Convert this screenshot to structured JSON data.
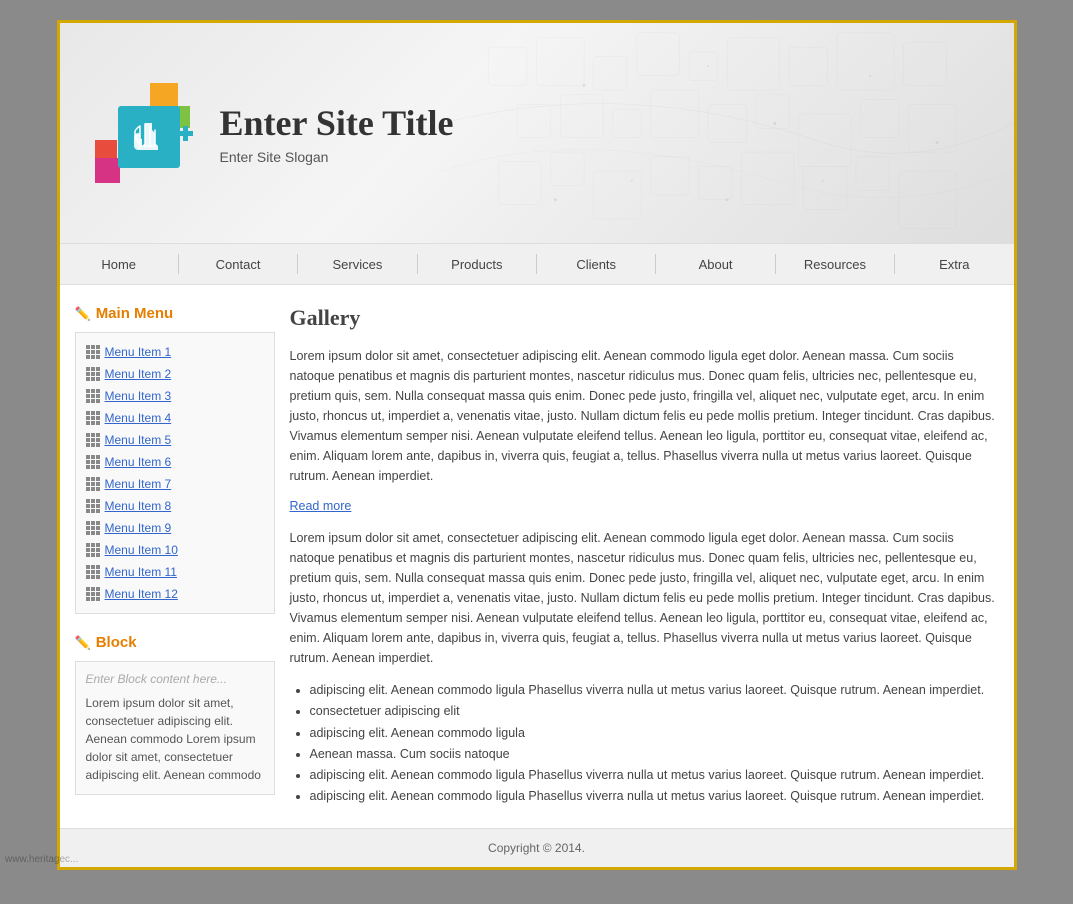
{
  "header": {
    "site_title": "Enter Site Title",
    "site_slogan": "Enter Site Slogan"
  },
  "nav": {
    "items": [
      {
        "label": "Home"
      },
      {
        "label": "Contact"
      },
      {
        "label": "Services"
      },
      {
        "label": "Products"
      },
      {
        "label": "Clients"
      },
      {
        "label": "About"
      },
      {
        "label": "Resources"
      },
      {
        "label": "Extra"
      }
    ]
  },
  "sidebar": {
    "main_menu_title": "Main Menu",
    "menu_items": [
      {
        "label": "Menu Item 1"
      },
      {
        "label": "Menu Item 2"
      },
      {
        "label": "Menu Item 3"
      },
      {
        "label": "Menu Item 4"
      },
      {
        "label": "Menu Item 5"
      },
      {
        "label": "Menu Item 6"
      },
      {
        "label": "Menu Item 7"
      },
      {
        "label": "Menu Item 8"
      },
      {
        "label": "Menu Item 9"
      },
      {
        "label": "Menu Item 10"
      },
      {
        "label": "Menu Item 11"
      },
      {
        "label": "Menu Item 12"
      }
    ],
    "block_title": "Block",
    "block_placeholder": "Enter Block content here...",
    "block_text": "Lorem ipsum dolor sit amet, consectetuer adipiscing elit. Aenean commodo Lorem ipsum dolor sit amet, consectetuer adipiscing elit. Aenean commodo"
  },
  "main": {
    "page_title": "Gallery",
    "paragraph1": "Lorem ipsum dolor sit amet, consectetuer adipiscing elit. Aenean commodo ligula eget dolor. Aenean massa. Cum sociis natoque penatibus et magnis dis parturient montes, nascetur ridiculus mus. Donec quam felis, ultricies nec, pellentesque eu, pretium quis, sem. Nulla consequat massa quis enim. Donec pede justo, fringilla vel, aliquet nec, vulputate eget, arcu. In enim justo, rhoncus ut, imperdiet a, venenatis vitae, justo. Nullam dictum felis eu pede mollis pretium. Integer tincidunt. Cras dapibus. Vivamus elementum semper nisi. Aenean vulputate eleifend tellus. Aenean leo ligula, porttitor eu, consequat vitae, eleifend ac, enim. Aliquam lorem ante, dapibus in, viverra quis, feugiat a, tellus. Phasellus viverra nulla ut metus varius laoreet. Quisque rutrum. Aenean imperdiet.",
    "read_more": "Read more",
    "paragraph2": "Lorem ipsum dolor sit amet, consectetuer adipiscing elit. Aenean commodo ligula eget dolor. Aenean massa. Cum sociis natoque penatibus et magnis dis parturient montes, nascetur ridiculus mus. Donec quam felis, ultricies nec, pellentesque eu, pretium quis, sem. Nulla consequat massa quis enim. Donec pede justo, fringilla vel, aliquet nec, vulputate eget, arcu. In enim justo, rhoncus ut, imperdiet a, venenatis vitae, justo. Nullam dictum felis eu pede mollis pretium. Integer tincidunt. Cras dapibus. Vivamus elementum semper nisi. Aenean vulputate eleifend tellus. Aenean leo ligula, porttitor eu, consequat vitae, eleifend ac, enim. Aliquam lorem ante, dapibus in, viverra quis, feugiat a, tellus. Phasellus viverra nulla ut metus varius laoreet. Quisque rutrum. Aenean imperdiet.",
    "list_items": [
      "adipiscing elit. Aenean commodo ligula Phasellus viverra nulla ut metus varius laoreet. Quisque rutrum. Aenean imperdiet.",
      "consectetuer adipiscing elit",
      "adipiscing elit. Aenean commodo ligula",
      "Aenean massa. Cum sociis natoque",
      "adipiscing elit. Aenean commodo ligula Phasellus viverra nulla ut metus varius laoreet. Quisque rutrum. Aenean imperdiet.",
      "adipiscing elit. Aenean commodo ligula Phasellus viverra nulla ut metus varius laoreet. Quisque rutrum. Aenean imperdiet."
    ]
  },
  "footer": {
    "copyright": "Copyright © 2014."
  },
  "watermark": "www.heritagec..."
}
